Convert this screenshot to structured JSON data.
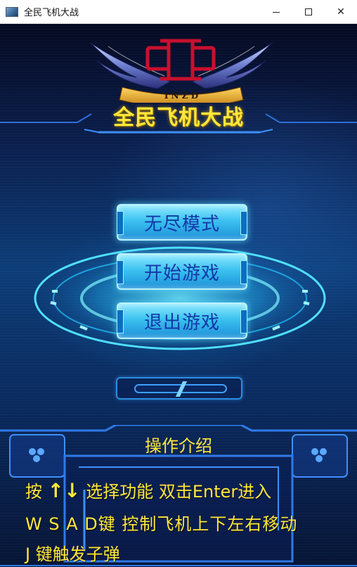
{
  "window": {
    "title": "全民飞机大战",
    "minimize": "—",
    "maximize": "☐",
    "close": "✕"
  },
  "logo": {
    "letters": "I N Z D"
  },
  "game": {
    "title": "全民飞机大战"
  },
  "menu": {
    "items": [
      {
        "label": "无尽模式"
      },
      {
        "label": "开始游戏"
      },
      {
        "label": "退出游戏"
      }
    ]
  },
  "help": {
    "title": "操作介绍",
    "line1_prefix": "按",
    "line1_up": "↑",
    "line1_down": "↓",
    "line1_text": " 选择功能  双击Enter进入",
    "line2": "W S A D键 控制飞机上下左右移动",
    "line3": "J 键触发子弹"
  },
  "colors": {
    "accent_yellow": "#ffe83a",
    "button_text": "#1338a8",
    "button_fill": "#3cc2f0"
  }
}
